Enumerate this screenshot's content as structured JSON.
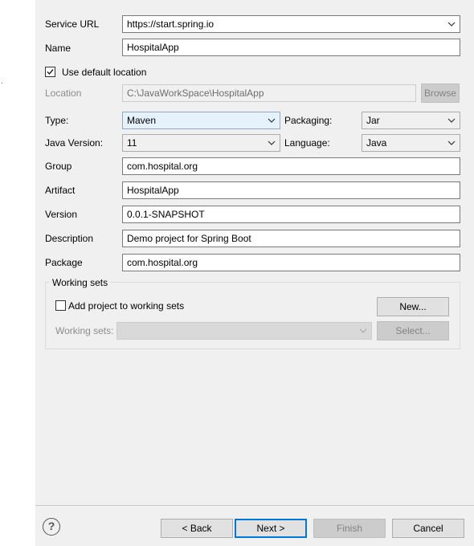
{
  "form": {
    "service_url": {
      "label": "Service URL",
      "value": "https://start.spring.io"
    },
    "name": {
      "label": "Name",
      "value": "HospitalApp"
    },
    "use_default_location": {
      "label": "Use default location",
      "checked": true
    },
    "location": {
      "label": "Location",
      "value": "C:\\JavaWorkSpace\\HospitalApp",
      "browse_label": "Browse"
    },
    "type": {
      "label": "Type:",
      "value": "Maven"
    },
    "packaging": {
      "label": "Packaging:",
      "value": "Jar"
    },
    "java_version": {
      "label": "Java Version:",
      "value": "11"
    },
    "language": {
      "label": "Language:",
      "value": "Java"
    },
    "group": {
      "label": "Group",
      "value": "com.hospital.org"
    },
    "artifact": {
      "label": "Artifact",
      "value": "HospitalApp"
    },
    "version": {
      "label": "Version",
      "value": "0.0.1-SNAPSHOT"
    },
    "description": {
      "label": "Description",
      "value": "Demo project for Spring Boot"
    },
    "package": {
      "label": "Package",
      "value": "com.hospital.org"
    }
  },
  "working_sets": {
    "title": "Working sets",
    "add_project_label": "Add project to working sets",
    "add_checked": false,
    "new_label": "New...",
    "sets_label": "Working sets:",
    "select_label": "Select..."
  },
  "footer": {
    "help_glyph": "?",
    "back_label": "< Back",
    "next_label": "Next >",
    "finish_label": "Finish",
    "cancel_label": "Cancel"
  },
  "left_dot": "."
}
